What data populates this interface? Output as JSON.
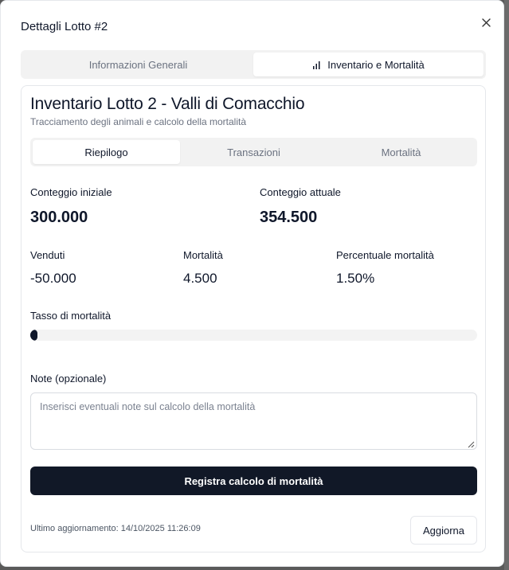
{
  "dialog": {
    "title": "Dettagli Lotto #2",
    "close_icon": "close-icon"
  },
  "main_tabs": [
    {
      "label": "Informazioni Generali",
      "active": false
    },
    {
      "label": "Inventario e Mortalità",
      "active": true,
      "icon": "bar-chart-icon"
    }
  ],
  "card": {
    "title": "Inventario Lotto 2 - Valli di Comacchio",
    "subtitle": "Tracciamento degli animali e calcolo della mortalità"
  },
  "sub_tabs": [
    {
      "label": "Riepilogo",
      "active": true
    },
    {
      "label": "Transazioni",
      "active": false
    },
    {
      "label": "Mortalità",
      "active": false
    }
  ],
  "stats": {
    "initial_label": "Conteggio iniziale",
    "initial_value": "300.000",
    "current_label": "Conteggio attuale",
    "current_value": "354.500",
    "sold_label": "Venduti",
    "sold_value": "-50.000",
    "mortality_label": "Mortalità",
    "mortality_value": "4.500",
    "percent_label": "Percentuale mortalità",
    "percent_value": "1.50%"
  },
  "mortality_rate": {
    "label": "Tasso di mortalità",
    "percent": 1.5
  },
  "notes": {
    "label": "Note (opzionale)",
    "placeholder": "Inserisci eventuali note sul calcolo della mortalità",
    "value": ""
  },
  "actions": {
    "register_label": "Registra calcolo di mortalità",
    "refresh_label": "Aggiorna"
  },
  "footer": {
    "last_update": "Ultimo aggiornamento: 14/10/2025 11:26:09"
  },
  "colors": {
    "primary": "#111827",
    "tab_bg": "#f2f2f2",
    "muted_text": "#6b7280"
  }
}
